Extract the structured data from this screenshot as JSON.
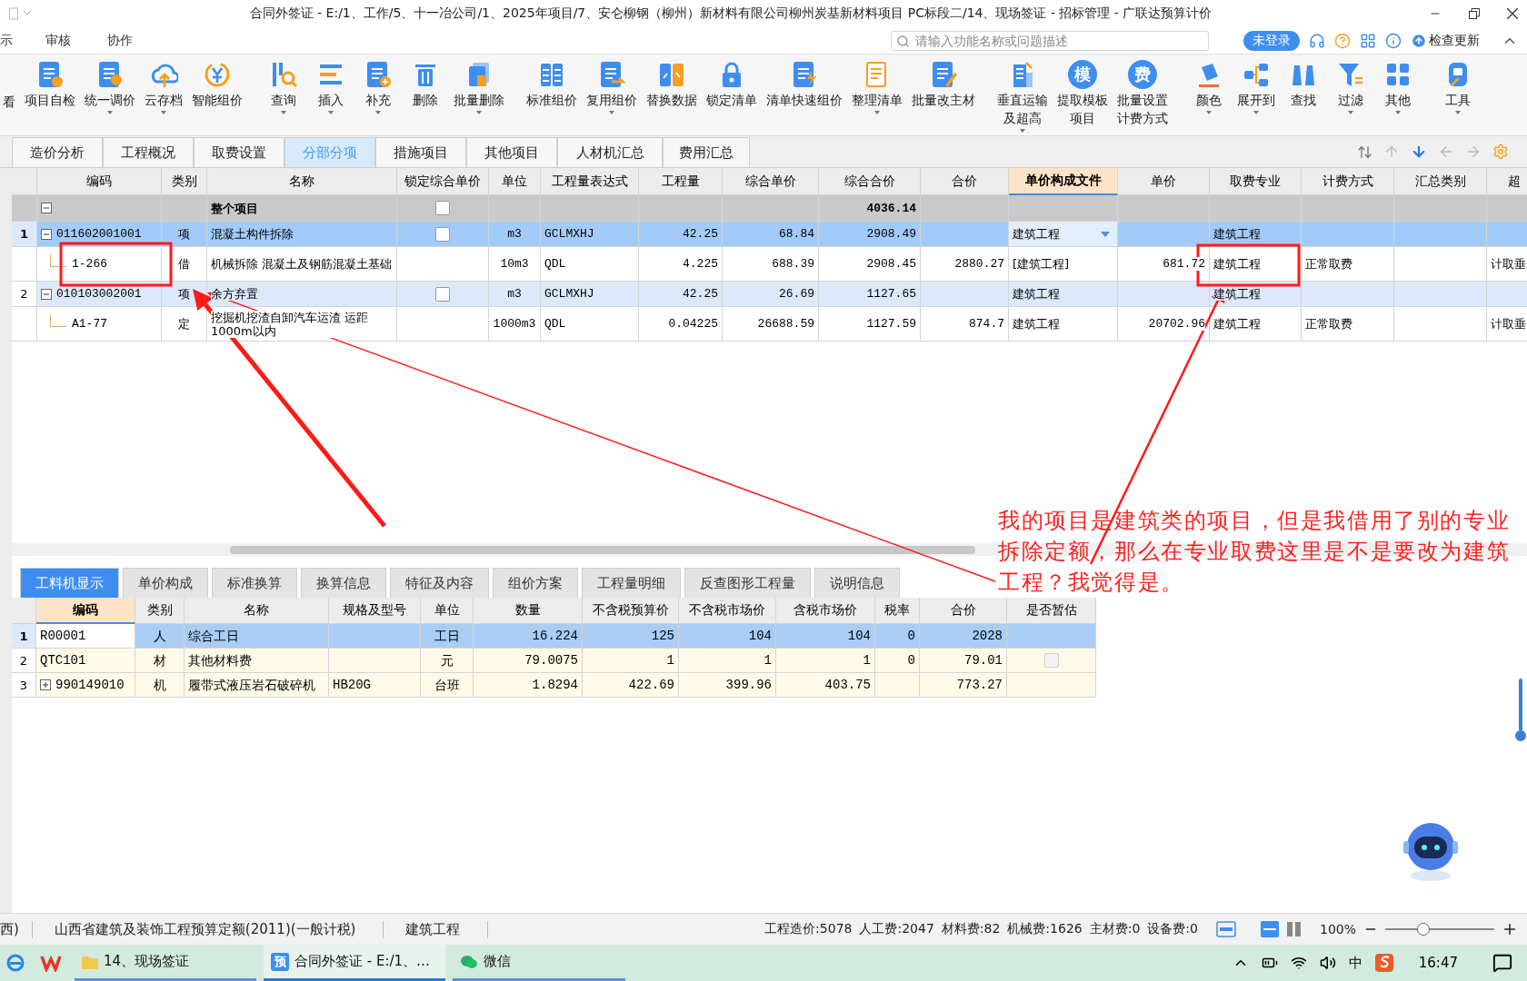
{
  "window": {
    "title": "合同外签证 - E:/1、工作/5、十一冶公司/1、2025年项目/7、安仑柳钢（柳州）新材料有限公司柳州炭基新材料项目 PC标段二/14、现场签证 - 招标管理 - 广联达预算计价"
  },
  "menu": [
    "示",
    "审核",
    "协作"
  ],
  "search": {
    "placeholder": "请输入功能名称或问题描述"
  },
  "account": {
    "login": "未登录",
    "update": "检查更新"
  },
  "toolbar": [
    {
      "lines": [
        "看"
      ],
      "dropdown": false
    },
    {
      "lines": [
        "项目自检"
      ],
      "dropdown": false
    },
    {
      "lines": [
        "统一调价"
      ],
      "dropdown": true
    },
    {
      "lines": [
        "云存档"
      ],
      "dropdown": true
    },
    {
      "lines": [
        "智能组价"
      ],
      "dropdown": false
    },
    {
      "lines": [
        "查询"
      ],
      "dropdown": true
    },
    {
      "lines": [
        "插入"
      ],
      "dropdown": true
    },
    {
      "lines": [
        "补充"
      ],
      "dropdown": true
    },
    {
      "lines": [
        "删除"
      ],
      "dropdown": false
    },
    {
      "lines": [
        "批量删除"
      ],
      "dropdown": true
    },
    {
      "lines": [
        "标准组价"
      ],
      "dropdown": false
    },
    {
      "lines": [
        "复用组价"
      ],
      "dropdown": true
    },
    {
      "lines": [
        "替换数据"
      ],
      "dropdown": false
    },
    {
      "lines": [
        "锁定清单"
      ],
      "dropdown": false
    },
    {
      "lines": [
        "清单快速组价"
      ],
      "dropdown": false
    },
    {
      "lines": [
        "整理清单"
      ],
      "dropdown": true
    },
    {
      "lines": [
        "批量改主材"
      ],
      "dropdown": false
    },
    {
      "lines": [
        "垂直运输",
        "及超高"
      ],
      "dropdown": true
    },
    {
      "lines": [
        "提取模板",
        "项目"
      ],
      "dropdown": false,
      "icon_text": "模"
    },
    {
      "lines": [
        "批量设置",
        "计费方式"
      ],
      "dropdown": false,
      "icon_text": "费"
    },
    {
      "lines": [
        "颜色"
      ],
      "dropdown": true
    },
    {
      "lines": [
        "展开到"
      ],
      "dropdown": true
    },
    {
      "lines": [
        "查找"
      ],
      "dropdown": false
    },
    {
      "lines": [
        "过滤"
      ],
      "dropdown": true
    },
    {
      "lines": [
        "其他"
      ],
      "dropdown": true
    },
    {
      "lines": [
        "工具"
      ],
      "dropdown": true
    }
  ],
  "tabs": [
    {
      "label": "造价分析",
      "selected": false
    },
    {
      "label": "工程概况",
      "selected": false
    },
    {
      "label": "取费设置",
      "selected": false
    },
    {
      "label": "分部分项",
      "selected": true
    },
    {
      "label": "措施项目",
      "selected": false
    },
    {
      "label": "其他项目",
      "selected": false
    },
    {
      "label": "人材机汇总",
      "selected": false
    },
    {
      "label": "费用汇总",
      "selected": false
    }
  ],
  "main_table": {
    "columns": [
      {
        "label": "编码",
        "selected": false
      },
      {
        "label": "类别",
        "selected": false
      },
      {
        "label": "名称",
        "selected": false
      },
      {
        "label": "锁定综合单价",
        "selected": false
      },
      {
        "label": "单位",
        "selected": false
      },
      {
        "label": "工程量表达式",
        "selected": false
      },
      {
        "label": "工程量",
        "selected": false
      },
      {
        "label": "综合单价",
        "selected": false
      },
      {
        "label": "综合合价",
        "selected": false
      },
      {
        "label": "合价",
        "selected": false
      },
      {
        "label": "单价构成文件",
        "selected": true
      },
      {
        "label": "单价",
        "selected": false
      },
      {
        "label": "取费专业",
        "selected": false
      },
      {
        "label": "计费方式",
        "selected": false
      },
      {
        "label": "汇总类别",
        "selected": false
      },
      {
        "label": "超",
        "selected": false
      }
    ],
    "rows": [
      {
        "kind": "group",
        "expanded": true,
        "selected": false,
        "editing": false,
        "locked": false,
        "cells": [
          null,
          null,
          "整个项目",
          null,
          null,
          null,
          null,
          null,
          "4036.14",
          null,
          null,
          null,
          null,
          null,
          null,
          null
        ]
      },
      {
        "kind": "item",
        "number": "1",
        "expanded": true,
        "selected": true,
        "editing": true,
        "locked": false,
        "cells": [
          "011602001001",
          "项",
          "混凝土构件拆除",
          null,
          "m3",
          "GCLMXHJ",
          "42.25",
          "68.84",
          "2908.49",
          null,
          "建筑工程",
          null,
          "建筑工程",
          null,
          null,
          null
        ]
      },
      {
        "kind": "sub",
        "selected": false,
        "editing": false,
        "cells": [
          "1-266",
          "借",
          "机械拆除 混凝土及钢筋混凝土基础",
          null,
          "10m3",
          "QDL",
          "4.225",
          "688.39",
          "2908.45",
          "2880.27",
          "[建筑工程]",
          "681.72",
          "建筑工程",
          "正常取费",
          null,
          "计取垂"
        ]
      },
      {
        "kind": "item",
        "number": "2",
        "expanded": true,
        "selected": false,
        "editing": false,
        "locked": false,
        "cells": [
          "010103002001",
          "项",
          "余方弃置",
          null,
          "m3",
          "GCLMXHJ",
          "42.25",
          "26.69",
          "1127.65",
          null,
          "建筑工程",
          null,
          "建筑工程",
          null,
          null,
          null
        ]
      },
      {
        "kind": "sub",
        "selected": false,
        "editing": false,
        "cells": [
          "A1-77",
          "定",
          "挖掘机挖渣自卸汽车运渣 运距1000m以内",
          null,
          "1000m3",
          "QDL",
          "0.04225",
          "26688.59",
          "1127.59",
          "874.7",
          "建筑工程",
          "20702.96",
          "建筑工程",
          "正常取费",
          null,
          "计取垂"
        ]
      }
    ]
  },
  "annotation": {
    "text": "我的项目是建筑类的项目，但是我借用了别的专业拆除定额，那么在专业取费这里是不是要改为建筑工程？我觉得是。"
  },
  "detail_tabs": [
    {
      "label": "工料机显示",
      "selected": true
    },
    {
      "label": "单价构成",
      "selected": false
    },
    {
      "label": "标准换算",
      "selected": false
    },
    {
      "label": "换算信息",
      "selected": false
    },
    {
      "label": "特征及内容",
      "selected": false
    },
    {
      "label": "组价方案",
      "selected": false
    },
    {
      "label": "工程量明细",
      "selected": false
    },
    {
      "label": "反查图形工程量",
      "selected": false
    },
    {
      "label": "说明信息",
      "selected": false
    }
  ],
  "detail_table": {
    "columns": [
      {
        "label": "编码",
        "selected": true
      },
      {
        "label": "类别",
        "selected": false
      },
      {
        "label": "名称",
        "selected": false
      },
      {
        "label": "规格及型号",
        "selected": false
      },
      {
        "label": "单位",
        "selected": false
      },
      {
        "label": "数量",
        "selected": false
      },
      {
        "label": "不含税预算价",
        "selected": false
      },
      {
        "label": "不含税市场价",
        "selected": false
      },
      {
        "label": "含税市场价",
        "selected": false
      },
      {
        "label": "税率",
        "selected": false
      },
      {
        "label": "合价",
        "selected": false
      },
      {
        "label": "是否暂估",
        "selected": false
      }
    ],
    "rows": [
      {
        "number": "1",
        "kind": "plain",
        "selected": true,
        "cells": [
          "R00001",
          "人",
          "综合工日",
          null,
          "工日",
          "16.224",
          "125",
          "104",
          "104",
          "0",
          "2028",
          null
        ]
      },
      {
        "number": "2",
        "kind": "plain",
        "selected": false,
        "estimated": false,
        "cells": [
          "QTC101",
          "材",
          "其他材料费",
          null,
          "元",
          "79.0075",
          "1",
          "1",
          "1",
          "0",
          "79.01",
          null
        ]
      },
      {
        "number": "3",
        "kind": "parent",
        "expanded": false,
        "selected": false,
        "cells": [
          "990149010",
          "机",
          "履带式液压岩石破碎机",
          "HB20G",
          "台班",
          "1.8294",
          "422.69",
          "399.96",
          "403.75",
          null,
          "773.27",
          null
        ]
      }
    ]
  },
  "status_bar": {
    "items": [
      "西)",
      "山西省建筑及装饰工程预算定额(2011)(一般计税)",
      "建筑工程"
    ],
    "costs": [
      "工程造价:5078",
      "人工费:2047",
      "材料费:82",
      "机械费:1626",
      "主材费:0",
      "设备费:0"
    ],
    "zoom": {
      "label": "100%",
      "level": 0.33
    }
  },
  "taskbar": {
    "apps": [
      {
        "label": "14、现场签证",
        "kind": "folder",
        "selected": false
      },
      {
        "label": "合同外签证 - E:/1、…",
        "kind": "app",
        "icon_text": "预",
        "selected": true
      },
      {
        "label": "微信",
        "kind": "chat",
        "selected": false
      }
    ],
    "ime": "中",
    "time": "16:47"
  }
}
